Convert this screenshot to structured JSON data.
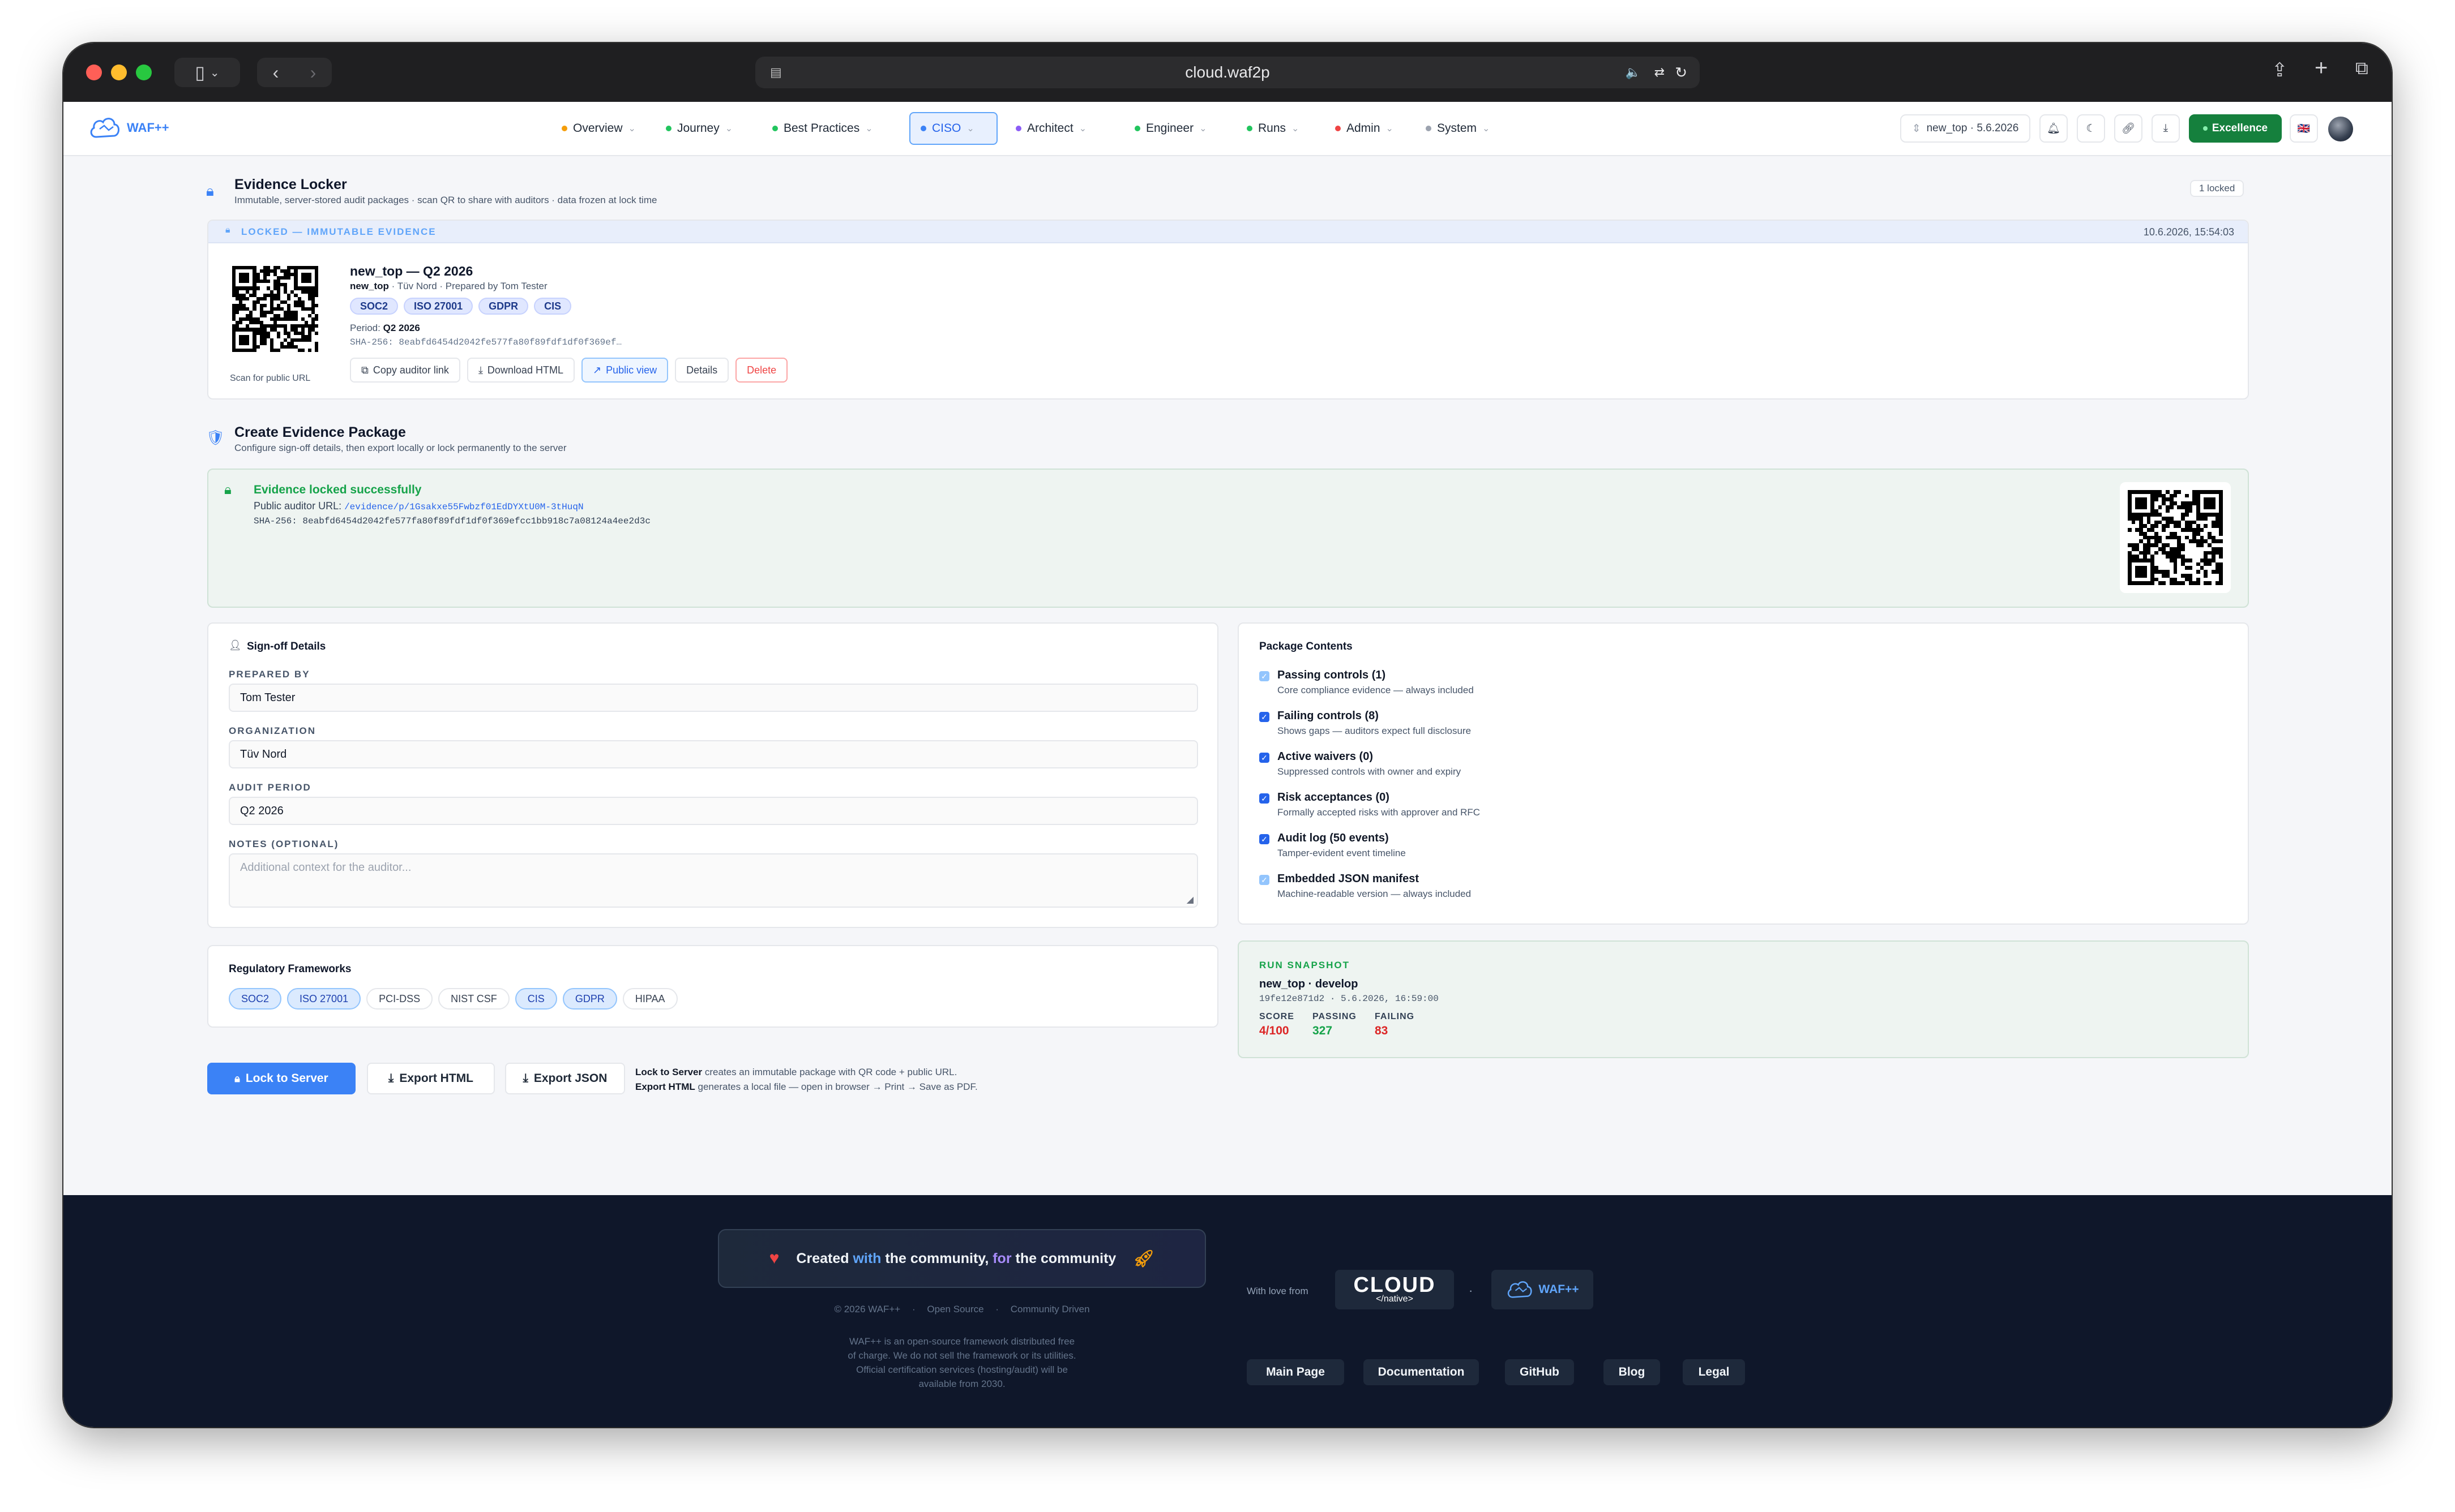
{
  "browser": {
    "url": "cloud.waf2p"
  },
  "app": {
    "logo_text": "WAF++",
    "nav": [
      {
        "label": "Overview",
        "dot": "#f59e0b"
      },
      {
        "label": "Journey",
        "dot": "#22c55e"
      },
      {
        "label": "Best Practices",
        "dot": "#22c55e"
      },
      {
        "label": "CISO",
        "dot": "#3b82f6"
      },
      {
        "label": "Architect",
        "dot": "#8b5cf6"
      },
      {
        "label": "Engineer",
        "dot": "#22c55e"
      },
      {
        "label": "Runs",
        "dot": "#22c55e"
      },
      {
        "label": "Admin",
        "dot": "#ef4444"
      },
      {
        "label": "System",
        "dot": "#9ca3af"
      }
    ],
    "run_selector": "new_top · 5.6.2026",
    "excellence_badge": "Excellence"
  },
  "locker": {
    "title": "Evidence Locker",
    "subtitle": "Immutable, server-stored audit packages · scan QR to share with auditors · data frozen at lock time",
    "count_badge": "1 locked",
    "banner_label": "LOCKED — IMMUTABLE EVIDENCE",
    "banner_time": "10.6.2026, 15:54:03",
    "item": {
      "title": "new_top — Q2 2026",
      "meta_strong": "new_top",
      "meta_rest": " · Tüv Nord · Prepared by Tom Tester",
      "tags": [
        "SOC2",
        "ISO 27001",
        "GDPR",
        "CIS"
      ],
      "period_label": "Period: ",
      "period_value": "Q2 2026",
      "sha": "SHA-256: 8eabfd6454d2042fe577fa80f89fdf1df0f369ef…",
      "qr_caption": "Scan for public URL",
      "buttons": {
        "copy": "Copy auditor link",
        "download": "Download HTML",
        "public": "Public view",
        "details": "Details",
        "delete": "Delete"
      }
    }
  },
  "create": {
    "title": "Create Evidence Package",
    "subtitle": "Configure sign-off details, then export locally or lock permanently to the server",
    "success": {
      "title": "Evidence locked successfully",
      "url_label": "Public auditor URL: ",
      "url_value": "/evidence/p/1Gsakxe55Fwbzf01EdDYXtU0M-3tHuqN",
      "sha": "SHA-256: 8eabfd6454d2042fe577fa80f89fdf1df0f369efcc1bb918c7a08124a4ee2d3c"
    }
  },
  "signoff": {
    "title": "Sign-off Details",
    "prepared_by_label": "PREPARED BY",
    "prepared_by_value": "Tom Tester",
    "organization_label": "ORGANIZATION",
    "organization_value": "Tüv Nord",
    "period_label": "AUDIT PERIOD",
    "period_value": "Q2 2026",
    "notes_label": "NOTES (OPTIONAL)",
    "notes_placeholder": "Additional context for the auditor..."
  },
  "contents": {
    "title": "Package Contents",
    "items": [
      {
        "title": "Passing controls (1)",
        "sub": "Core compliance evidence — always included"
      },
      {
        "title": "Failing controls (8)",
        "sub": "Shows gaps — auditors expect full disclosure"
      },
      {
        "title": "Active waivers (0)",
        "sub": "Suppressed controls with owner and expiry"
      },
      {
        "title": "Risk acceptances (0)",
        "sub": "Formally accepted risks with approver and RFC"
      },
      {
        "title": "Audit log (50 events)",
        "sub": "Tamper-evident event timeline"
      },
      {
        "title": "Embedded JSON manifest",
        "sub": "Machine-readable version — always included"
      }
    ]
  },
  "frameworks": {
    "title": "Regulatory Frameworks",
    "items": [
      "SOC2",
      "ISO 27001",
      "PCI-DSS",
      "NIST CSF",
      "CIS",
      "GDPR",
      "HIPAA"
    ]
  },
  "snapshot": {
    "label": "RUN SNAPSHOT",
    "name": "new_top · develop",
    "meta": "19fe12e871d2 · 5.6.2026, 16:59:00",
    "score_label": "SCORE",
    "score_value": "4/100",
    "passing_label": "PASSING",
    "passing_value": "327",
    "failing_label": "FAILING",
    "failing_value": "83"
  },
  "actions": {
    "lock": "Lock to Server",
    "export_html": "Export HTML",
    "export_json": "Export JSON",
    "help_1_strong": "Lock to Server",
    "help_1_rest": " creates an immutable package with QR code + public URL.",
    "help_2_strong": "Export HTML",
    "help_2_rest": " generates a local file — open in browser → Print → Save as PDF."
  },
  "footer": {
    "community_1": "Created ",
    "community_2": "with",
    "community_3": " the community, ",
    "community_4": "for",
    "community_5": " the community",
    "copyright": "© 2026 WAF++",
    "open_source": "Open Source",
    "community_driven": "Community Driven",
    "disclaimer_1": "WAF++ is an open-source framework distributed free",
    "disclaimer_2": "of charge. We do not sell the framework or its utilities.",
    "disclaimer_3": "Official certification services (hosting/audit) will be",
    "disclaimer_4": "available from 2030.",
    "with_love": "With love from",
    "cloud_logo": "CLOUD",
    "cloud_sub": "</native>",
    "waf_logo": "WAF++",
    "links": [
      "Main Page",
      "Documentation",
      "GitHub",
      "Blog",
      "Legal"
    ]
  }
}
